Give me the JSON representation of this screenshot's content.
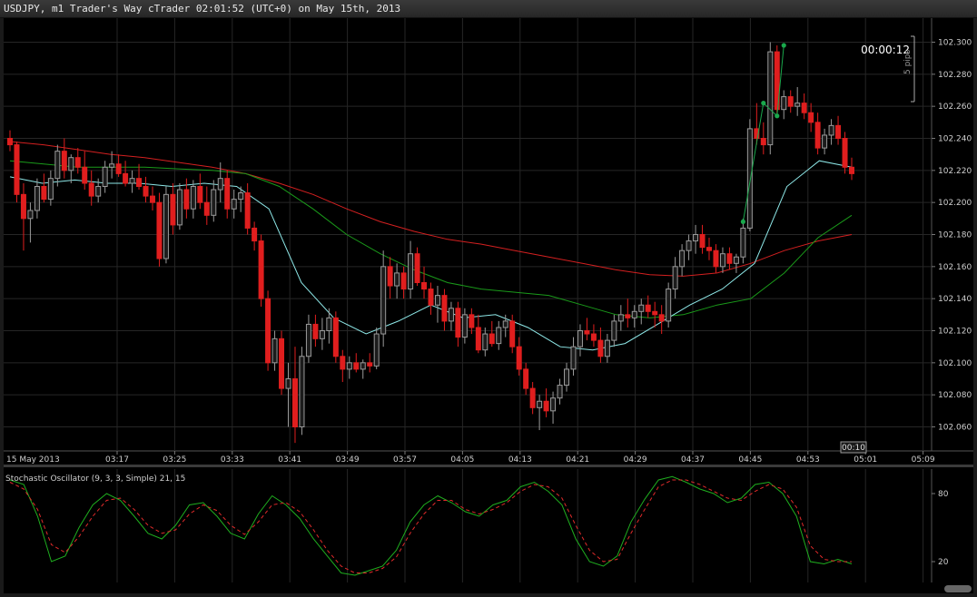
{
  "window": {
    "title": "USDJPY, m1 Trader's Way cTrader 02:01:52 (UTC+0) on May 15th, 2013"
  },
  "countdown": "00:00:12",
  "pips_label": "5 pips",
  "price_axis": {
    "ticks": [
      "102.300",
      "102.280",
      "102.260",
      "102.240",
      "102.220",
      "102.200",
      "102.180",
      "102.160",
      "102.140",
      "102.120",
      "102.100",
      "102.080",
      "102.060"
    ]
  },
  "time_axis": {
    "date_label": "15 May 2013",
    "ticks": [
      "03:17",
      "03:25",
      "03:33",
      "03:41",
      "03:49",
      "03:57",
      "04:05",
      "04:13",
      "04:21",
      "04:29",
      "04:37",
      "04:45",
      "04:53",
      "05:01",
      "05:09"
    ],
    "cursor_label": "00:10"
  },
  "oscillator": {
    "label": "Stochastic Oscillator (9, 3, 3, Simple) 21, 15",
    "levels": [
      "80",
      "20"
    ]
  },
  "colors": {
    "up": "#1c1c1c",
    "up_outline": "#9a9a9a",
    "down": "#e01e1e",
    "ma_red": "#d42020",
    "ma_green": "#1a9a1a",
    "ma_cyan": "#8ee8e8",
    "k_line": "#1fae1f",
    "d_line": "#e02a2a",
    "signal": "#1aa84c"
  },
  "chart_data": {
    "type": "candlestick",
    "symbol": "USDJPY",
    "timeframe": "m1",
    "ylim": [
      102.045,
      102.315
    ],
    "candles": [
      [
        102.24,
        102.245,
        102.232,
        102.236
      ],
      [
        102.236,
        102.238,
        102.2,
        102.205
      ],
      [
        102.205,
        102.212,
        102.17,
        102.19
      ],
      [
        102.19,
        102.2,
        102.175,
        102.195
      ],
      [
        102.195,
        102.215,
        102.19,
        102.21
      ],
      [
        102.21,
        102.218,
        102.2,
        102.202
      ],
      [
        102.202,
        102.22,
        102.198,
        102.215
      ],
      [
        102.215,
        102.236,
        102.21,
        102.232
      ],
      [
        102.232,
        102.24,
        102.215,
        102.22
      ],
      [
        102.22,
        102.23,
        102.212,
        102.228
      ],
      [
        102.228,
        102.234,
        102.218,
        102.222
      ],
      [
        102.222,
        102.232,
        102.208,
        102.212
      ],
      [
        102.212,
        102.22,
        102.198,
        102.204
      ],
      [
        102.204,
        102.215,
        102.2,
        102.21
      ],
      [
        102.21,
        102.226,
        102.206,
        102.222
      ],
      [
        102.222,
        102.232,
        102.215,
        102.224
      ],
      [
        102.224,
        102.23,
        102.216,
        102.218
      ],
      [
        102.218,
        102.226,
        102.21,
        102.212
      ],
      [
        102.212,
        102.22,
        102.206,
        102.215
      ],
      [
        102.215,
        102.224,
        102.208,
        102.21
      ],
      [
        102.21,
        102.216,
        102.2,
        102.204
      ],
      [
        102.204,
        102.21,
        102.195,
        102.2
      ],
      [
        102.2,
        102.206,
        102.16,
        102.165
      ],
      [
        102.165,
        102.21,
        102.162,
        102.205
      ],
      [
        102.205,
        102.212,
        102.18,
        102.186
      ],
      [
        102.186,
        102.212,
        102.183,
        102.208
      ],
      [
        102.208,
        102.215,
        102.19,
        102.196
      ],
      [
        102.196,
        102.214,
        102.19,
        102.21
      ],
      [
        102.21,
        102.218,
        102.196,
        102.2
      ],
      [
        102.2,
        102.21,
        102.186,
        102.192
      ],
      [
        102.192,
        102.214,
        102.188,
        102.208
      ],
      [
        102.208,
        102.225,
        102.2,
        102.215
      ],
      [
        102.215,
        102.22,
        102.19,
        102.196
      ],
      [
        102.196,
        102.208,
        102.19,
        102.202
      ],
      [
        102.202,
        102.21,
        102.194,
        102.206
      ],
      [
        102.206,
        102.212,
        102.18,
        102.184
      ],
      [
        102.184,
        102.188,
        102.17,
        102.176
      ],
      [
        102.176,
        102.18,
        102.135,
        102.14
      ],
      [
        102.14,
        102.145,
        102.095,
        102.1
      ],
      [
        102.1,
        102.12,
        102.095,
        102.115
      ],
      [
        102.115,
        102.12,
        102.08,
        102.084
      ],
      [
        102.084,
        102.1,
        102.06,
        102.09
      ],
      [
        102.09,
        102.11,
        102.05,
        102.06
      ],
      [
        102.06,
        102.11,
        102.055,
        102.104
      ],
      [
        102.104,
        102.13,
        102.1,
        102.124
      ],
      [
        102.124,
        102.13,
        102.11,
        102.115
      ],
      [
        102.115,
        102.128,
        102.108,
        102.12
      ],
      [
        102.12,
        102.134,
        102.112,
        102.128
      ],
      [
        102.128,
        102.132,
        102.1,
        102.104
      ],
      [
        102.104,
        102.108,
        102.088,
        102.096
      ],
      [
        102.096,
        102.104,
        102.09,
        102.1
      ],
      [
        102.1,
        102.106,
        102.094,
        102.096
      ],
      [
        102.096,
        102.102,
        102.09,
        102.1
      ],
      [
        102.1,
        102.106,
        102.094,
        102.098
      ],
      [
        102.098,
        102.122,
        102.096,
        102.118
      ],
      [
        102.118,
        102.17,
        102.11,
        102.16
      ],
      [
        102.16,
        102.166,
        102.14,
        102.148
      ],
      [
        102.148,
        102.162,
        102.14,
        102.156
      ],
      [
        102.156,
        102.16,
        102.14,
        102.146
      ],
      [
        102.146,
        102.176,
        102.14,
        102.168
      ],
      [
        102.168,
        102.172,
        102.148,
        102.15
      ],
      [
        102.15,
        102.16,
        102.14,
        102.146
      ],
      [
        102.146,
        102.15,
        102.13,
        102.136
      ],
      [
        102.136,
        102.148,
        102.125,
        102.142
      ],
      [
        102.142,
        102.146,
        102.12,
        102.126
      ],
      [
        102.126,
        102.138,
        102.12,
        102.134
      ],
      [
        102.134,
        102.138,
        102.11,
        102.116
      ],
      [
        102.116,
        102.134,
        102.112,
        102.13
      ],
      [
        102.13,
        102.134,
        102.118,
        102.122
      ],
      [
        102.122,
        102.13,
        102.106,
        102.108
      ],
      [
        102.108,
        102.122,
        102.104,
        102.118
      ],
      [
        102.118,
        102.126,
        102.11,
        102.112
      ],
      [
        102.112,
        102.126,
        102.108,
        102.122
      ],
      [
        102.122,
        102.13,
        102.116,
        102.126
      ],
      [
        102.126,
        102.13,
        102.106,
        102.11
      ],
      [
        102.11,
        102.116,
        102.092,
        102.096
      ],
      [
        102.096,
        102.1,
        102.08,
        102.084
      ],
      [
        102.084,
        102.088,
        102.068,
        102.072
      ],
      [
        102.072,
        102.08,
        102.058,
        102.076
      ],
      [
        102.076,
        102.084,
        102.066,
        102.07
      ],
      [
        102.07,
        102.082,
        102.062,
        102.078
      ],
      [
        102.078,
        102.09,
        102.074,
        102.086
      ],
      [
        102.086,
        102.1,
        102.082,
        102.096
      ],
      [
        102.096,
        102.116,
        102.092,
        102.11
      ],
      [
        102.11,
        102.124,
        102.104,
        102.12
      ],
      [
        102.12,
        102.128,
        102.114,
        102.118
      ],
      [
        102.118,
        102.124,
        102.11,
        102.114
      ],
      [
        102.114,
        102.122,
        102.1,
        102.104
      ],
      [
        102.104,
        102.118,
        102.1,
        102.114
      ],
      [
        102.114,
        102.13,
        102.11,
        102.126
      ],
      [
        102.126,
        102.136,
        102.12,
        102.13
      ],
      [
        102.13,
        102.14,
        102.122,
        102.128
      ],
      [
        102.128,
        102.136,
        102.122,
        102.132
      ],
      [
        102.132,
        102.14,
        102.124,
        102.136
      ],
      [
        102.136,
        102.142,
        102.128,
        102.132
      ],
      [
        102.132,
        102.138,
        102.122,
        102.13
      ],
      [
        102.13,
        102.136,
        102.118,
        102.126
      ],
      [
        102.126,
        102.15,
        102.122,
        102.146
      ],
      [
        102.146,
        102.166,
        102.14,
        102.16
      ],
      [
        102.16,
        102.174,
        102.154,
        102.17
      ],
      [
        102.17,
        102.18,
        102.164,
        102.176
      ],
      [
        102.176,
        102.186,
        102.168,
        102.18
      ],
      [
        102.18,
        102.186,
        102.168,
        102.172
      ],
      [
        102.172,
        102.178,
        102.164,
        102.17
      ],
      [
        102.17,
        102.174,
        102.156,
        102.16
      ],
      [
        102.16,
        102.172,
        102.156,
        102.168
      ],
      [
        102.168,
        102.172,
        102.158,
        102.162
      ],
      [
        102.162,
        102.168,
        102.156,
        102.166
      ],
      [
        102.166,
        102.19,
        102.162,
        102.184
      ],
      [
        102.184,
        102.252,
        102.182,
        102.246
      ],
      [
        102.246,
        102.262,
        102.236,
        102.24
      ],
      [
        102.24,
        102.25,
        102.23,
        102.236
      ],
      [
        102.236,
        102.3,
        102.23,
        102.294
      ],
      [
        102.294,
        102.298,
        102.254,
        102.258
      ],
      [
        102.258,
        102.27,
        102.252,
        102.266
      ],
      [
        102.266,
        102.27,
        102.256,
        102.26
      ],
      [
        102.26,
        102.272,
        102.254,
        102.262
      ],
      [
        102.262,
        102.268,
        102.252,
        102.256
      ],
      [
        102.256,
        102.262,
        102.244,
        102.25
      ],
      [
        102.25,
        102.256,
        102.23,
        102.234
      ],
      [
        102.234,
        102.246,
        102.23,
        102.242
      ],
      [
        102.242,
        102.252,
        102.236,
        102.248
      ],
      [
        102.248,
        102.254,
        102.236,
        102.24
      ],
      [
        102.24,
        102.244,
        102.218,
        102.222
      ],
      [
        102.222,
        102.228,
        102.214,
        102.218
      ]
    ],
    "moving_averages": [
      {
        "color": "red",
        "points": [
          102.238,
          102.236,
          102.233,
          102.23,
          102.228,
          102.225,
          102.222,
          102.218,
          102.212,
          102.205,
          102.196,
          102.188,
          102.182,
          102.177,
          102.174,
          102.17,
          102.166,
          102.162,
          102.158,
          102.155,
          102.154,
          102.156,
          102.162,
          102.17,
          102.176,
          102.18
        ]
      },
      {
        "color": "green",
        "points": [
          102.226,
          102.224,
          102.222,
          102.222,
          102.222,
          102.221,
          102.22,
          102.218,
          102.21,
          102.196,
          102.18,
          102.168,
          102.158,
          102.15,
          102.146,
          102.144,
          102.142,
          102.136,
          102.13,
          102.128,
          102.13,
          102.136,
          102.14,
          102.156,
          102.178,
          102.192
        ]
      },
      {
        "color": "cyan",
        "points": [
          102.216,
          102.212,
          102.214,
          102.212,
          102.212,
          102.21,
          102.212,
          102.21,
          102.196,
          102.15,
          102.128,
          102.118,
          102.126,
          102.136,
          102.128,
          102.13,
          102.122,
          102.11,
          102.108,
          102.112,
          102.124,
          102.136,
          102.146,
          102.162,
          102.21,
          102.226,
          102.222
        ]
      }
    ],
    "signal_points": [
      102.188,
      102.262,
      102.254,
      102.298
    ],
    "stochastic": {
      "k": [
        92,
        88,
        60,
        20,
        25,
        50,
        70,
        80,
        74,
        60,
        45,
        40,
        52,
        70,
        72,
        60,
        45,
        40,
        62,
        78,
        70,
        58,
        40,
        25,
        10,
        8,
        12,
        16,
        30,
        55,
        70,
        78,
        72,
        64,
        60,
        70,
        74,
        86,
        90,
        82,
        70,
        40,
        20,
        16,
        25,
        55,
        75,
        92,
        95,
        90,
        84,
        80,
        72,
        76,
        88,
        90,
        80,
        60,
        20,
        18,
        22,
        18
      ],
      "d": [
        90,
        84,
        66,
        35,
        28,
        42,
        60,
        74,
        76,
        66,
        52,
        45,
        48,
        62,
        70,
        65,
        52,
        44,
        55,
        70,
        72,
        64,
        48,
        30,
        16,
        10,
        10,
        14,
        24,
        45,
        62,
        74,
        74,
        66,
        62,
        66,
        72,
        82,
        88,
        86,
        76,
        52,
        30,
        20,
        22,
        45,
        66,
        86,
        92,
        92,
        88,
        82,
        76,
        74,
        82,
        88,
        84,
        68,
        34,
        22,
        20,
        20
      ],
      "levels": [
        80,
        20
      ]
    }
  }
}
